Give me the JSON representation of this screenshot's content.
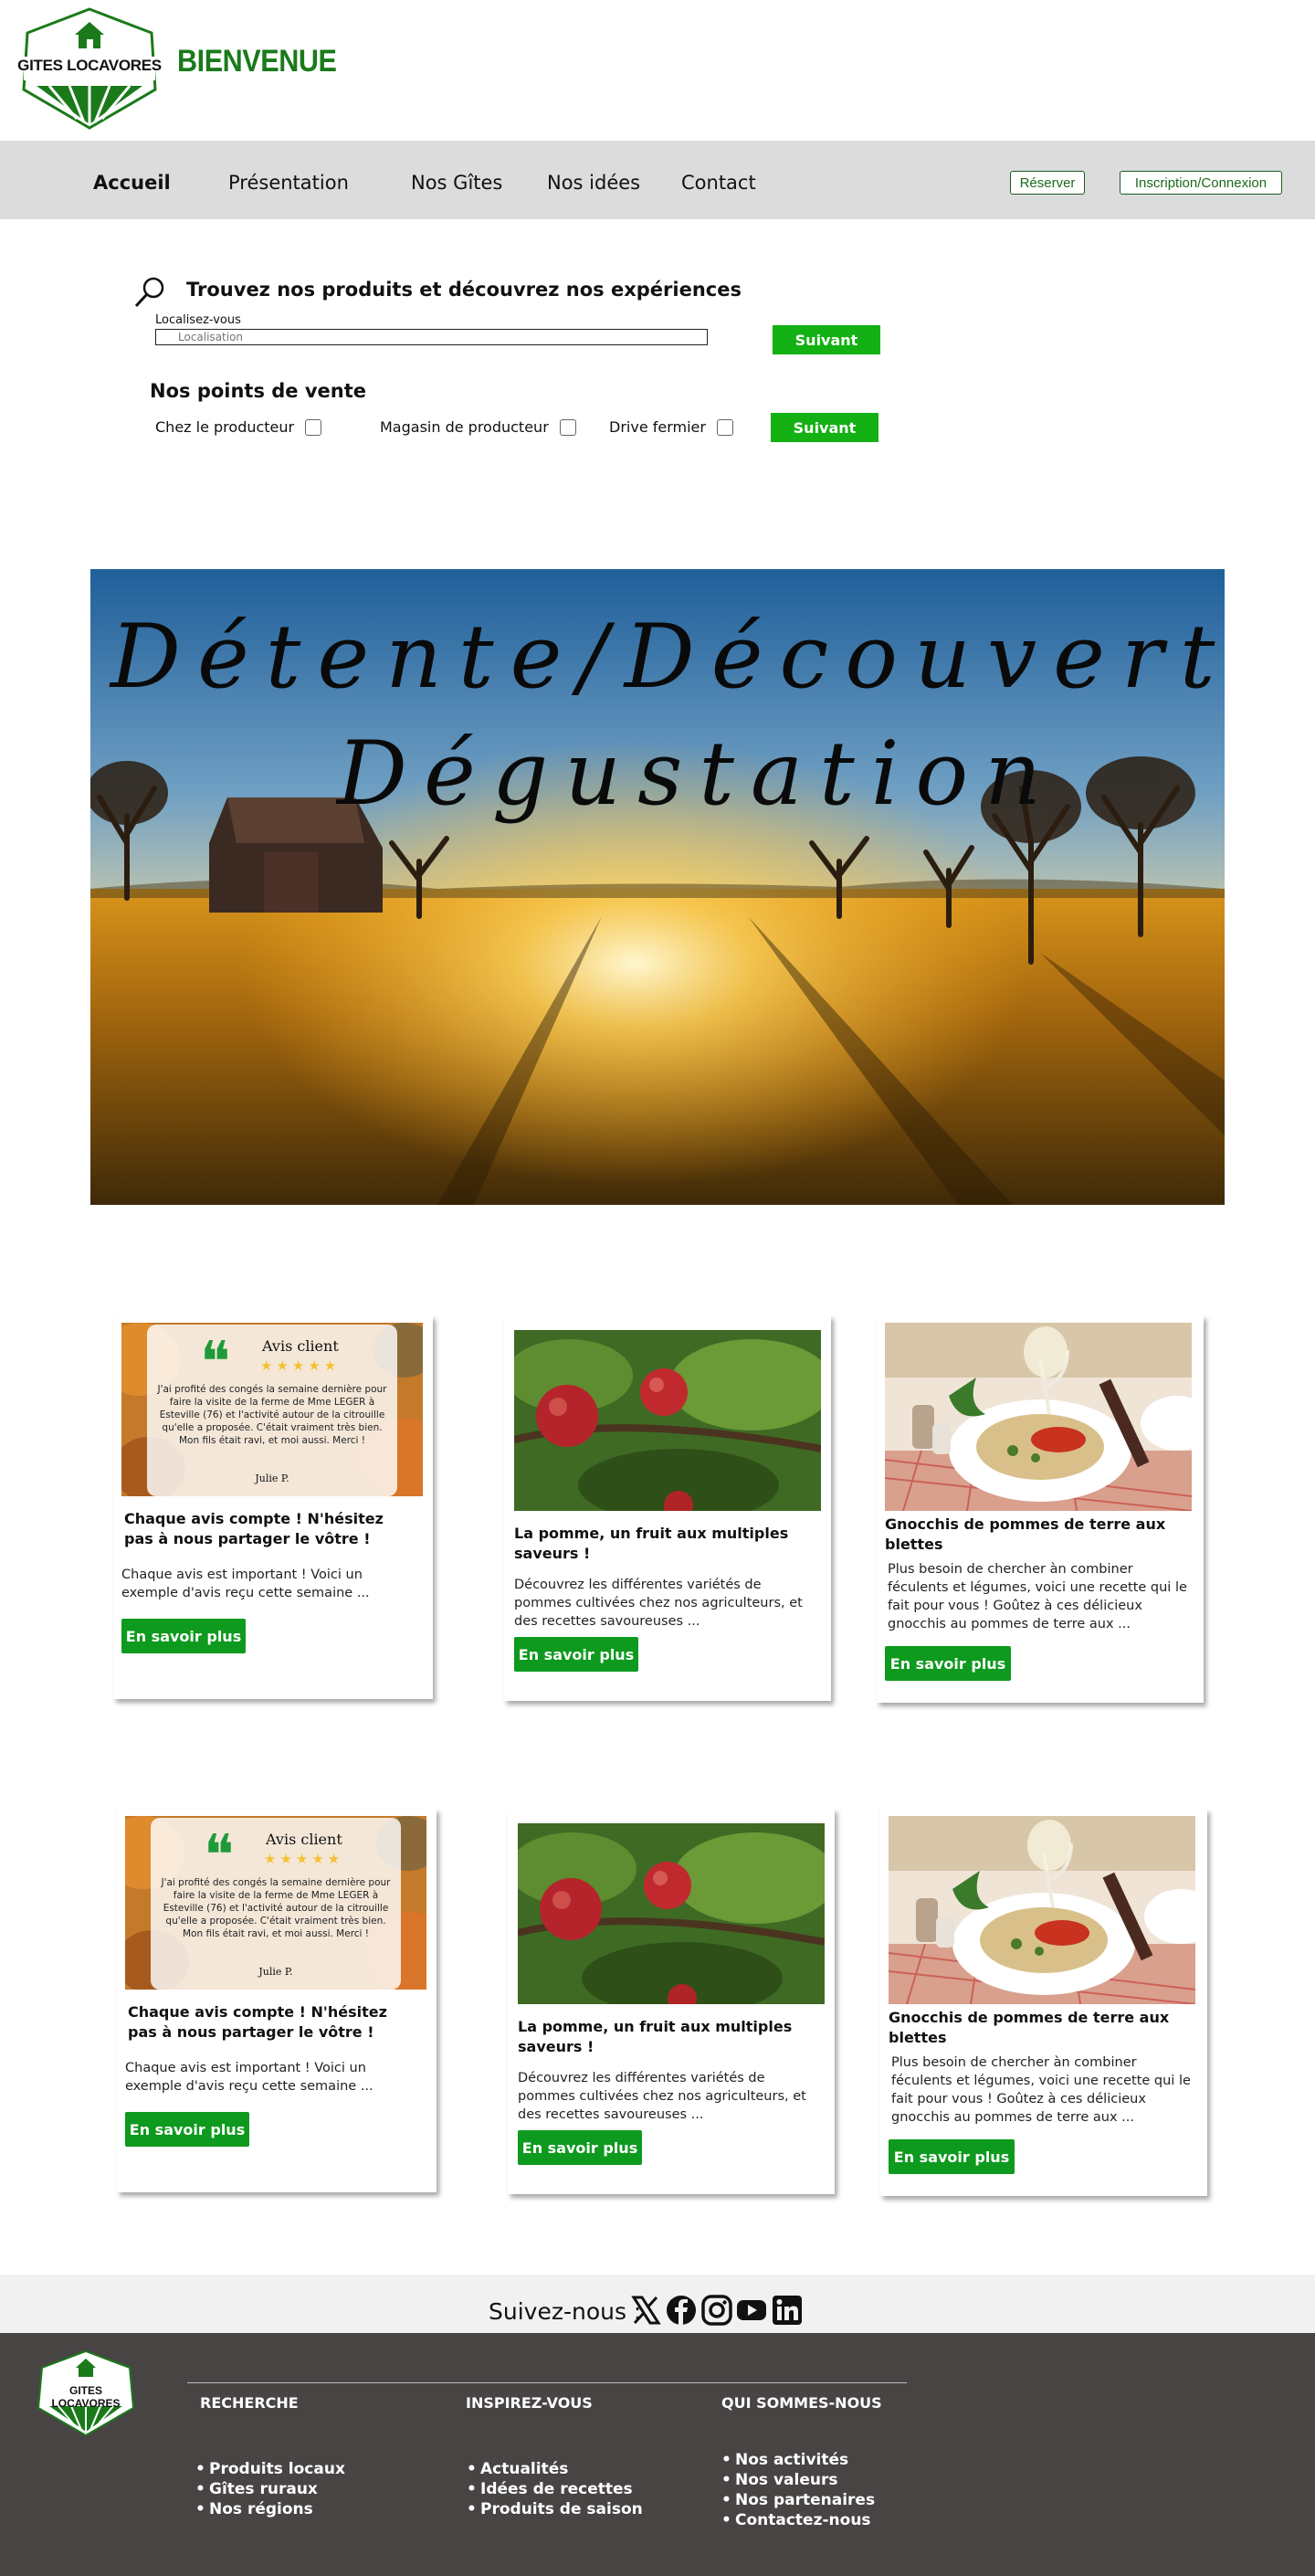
{
  "header": {
    "logo_text": "GITES LOCAVORES",
    "welcome": "BIENVENUE"
  },
  "nav": {
    "items": [
      "Accueil",
      "Présentation",
      "Nos Gîtes",
      "Nos idées",
      "Contact"
    ],
    "active": "Accueil",
    "reserve_label": "Réserver",
    "login_label": "Inscription/Connexion"
  },
  "search": {
    "title": "Trouvez nos produits et découvrez nos expériences",
    "location_label": "Localisez-vous",
    "location_placeholder": "Localisation",
    "next_label": "Suivant"
  },
  "points": {
    "title": "Nos points de vente",
    "options": [
      "Chez le producteur",
      "Magasin de producteur",
      "Drive fermier"
    ],
    "next_label": "Suivant"
  },
  "hero": {
    "line1": "Détente/Découverte",
    "line2": "Dégustation"
  },
  "cards": [
    {
      "kind": "review",
      "title": "Chaque avis compte ! N'hésitez pas à nous partager le vôtre !",
      "text": "Chaque avis est important ! Voici un exemple d'avis reçu cette semaine ...",
      "button": "En savoir plus",
      "review": {
        "heading": "Avis client",
        "stars": "★★★★★",
        "body": "J'ai profité des congés la semaine dernière pour faire la visite de la ferme de Mme LEGER à Esteville (76) et l'activité autour de la citrouille qu'elle a proposée. C'était vraiment très bien. Mon fils était ravi, et moi aussi. Merci !",
        "author": "Julie P."
      }
    },
    {
      "kind": "apple",
      "title": "La pomme, un fruit aux multiples saveurs !",
      "text": "Découvrez les différentes variétés de pommes cultivées chez nos agriculteurs, et des recettes savoureuses ...",
      "button": "En savoir plus"
    },
    {
      "kind": "gnocchi",
      "title": "Gnocchis de pommes de terre aux blettes",
      "text": "Plus besoin de chercher àn combiner féculents et légumes, voici une recette qui le fait pour vous ! Goûtez à ces délicieux gnocchis au pommes de terre aux ...",
      "button": "En savoir plus"
    }
  ],
  "social": {
    "label": "Suivez-nous :",
    "icons": [
      "x-icon",
      "facebook-icon",
      "instagram-icon",
      "youtube-icon",
      "linkedin-icon"
    ]
  },
  "footer": {
    "logo_text": "GITES LOCAVORES",
    "columns": [
      {
        "title": "RECHERCHE",
        "items": [
          "Produits locaux",
          "Gîtes ruraux",
          "Nos régions"
        ]
      },
      {
        "title": "INSPIREZ-VOUS",
        "items": [
          "Actualités",
          "Idées de recettes",
          "Produits de saison"
        ]
      },
      {
        "title": "QUI SOMMES-NOUS",
        "items": [
          "Nos activités",
          "Nos valeurs",
          "Nos partenaires",
          "Contactez-nous"
        ]
      }
    ]
  },
  "colors": {
    "brand_green": "#1a7a1a",
    "button_green": "#13b113",
    "nav_bg": "#dcdcdc",
    "footer_bg": "#474443"
  }
}
